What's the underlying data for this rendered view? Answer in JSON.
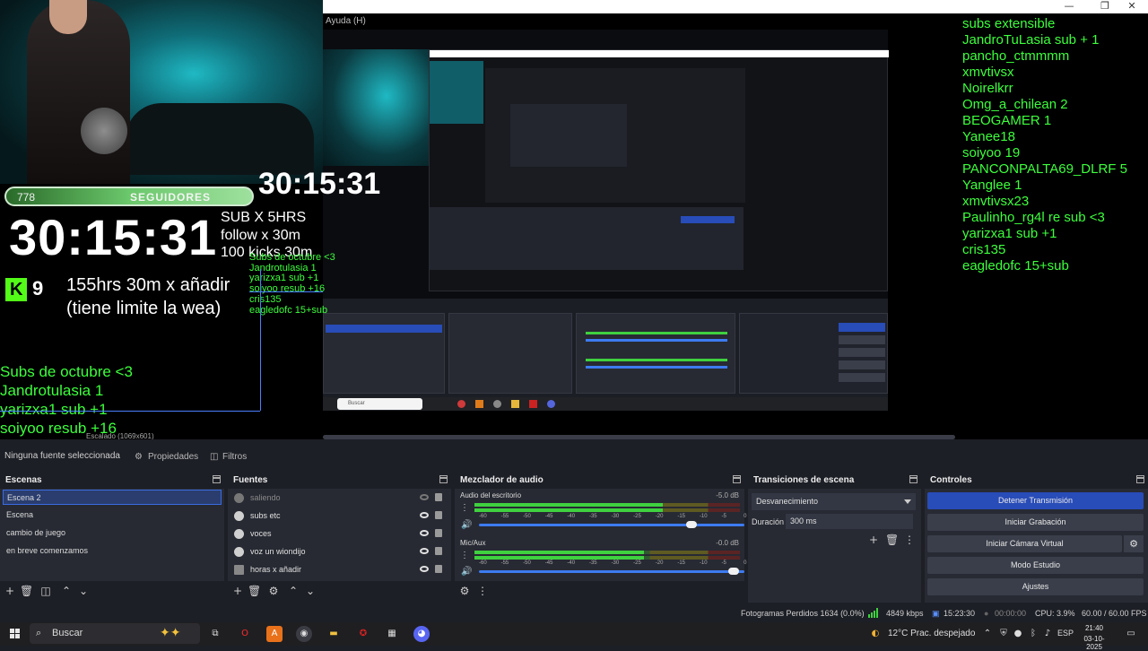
{
  "preview": {
    "menu_help": "Ayuda (H)",
    "followers_count": "778",
    "followers_label": "SEGUIDORES",
    "big_timer": "30:15:31",
    "overlay_timer": "30:15:31",
    "kick_count": "9",
    "limit_line1": "155hrs 30m  x añadir",
    "limit_line2": "(tiene limite la wea)",
    "rules": [
      "SUB X 5HRS",
      "follow x 30m",
      "100 kicks 30m"
    ],
    "left_list": [
      "Subs de octubre <3",
      "Jandrotulasia 1",
      "yarizxa1 sub +1",
      "soiyoo resub +16",
      "cris135",
      "eagledofc 15+sub"
    ],
    "right_list": [
      "subs extensible",
      "JandroTuLasia sub + 1",
      "pancho_ctmmmm",
      "xmvtivsx",
      "Noirelkrr",
      "Omg_a_chilean 2",
      "BEOGAMER 1",
      "Yanee18",
      "soiyoo 19",
      "PANCONPALTA69_DLRF 5",
      "Yanglee 1",
      "xmvtivsx23",
      "Paulinho_rg4l  re sub <3",
      "yarizxa1 sub +1",
      "cris135",
      "eagledofc 15+sub"
    ],
    "nested_search": "Buscar",
    "zoom_label": "Escalado (1069x601)"
  },
  "window_controls": {
    "minimize": "—",
    "maximize": "❐",
    "close": "✕"
  },
  "source_toolbar": {
    "no_source": "Ninguna fuente seleccionada",
    "properties": "Propiedades",
    "filters": "Filtros"
  },
  "scenes": {
    "title": "Escenas",
    "items": [
      "Escena 2",
      "Escena",
      "cambio de juego",
      "en breve comenzamos"
    ]
  },
  "sources": {
    "title": "Fuentes",
    "items": [
      "saliendo",
      "subs etc",
      "voces",
      "voz un wiondijo",
      "horas x añadir"
    ]
  },
  "mixer": {
    "title": "Mezclador de audio",
    "ticks": [
      "-60",
      "-55",
      "-50",
      "-45",
      "-40",
      "-35",
      "-30",
      "-25",
      "-20",
      "-15",
      "-10",
      "-5",
      "0"
    ],
    "channels": [
      {
        "name": "Audio del escritorio",
        "db": "-5.0 dB",
        "level": 0.71,
        "volume": 0.82
      },
      {
        "name": "Mic/Aux",
        "db": "-0.0 dB",
        "level": 0.64,
        "volume": 0.98
      }
    ]
  },
  "transitions": {
    "title": "Transiciones de escena",
    "selected": "Desvanecimiento",
    "duration_label": "Duración",
    "duration_value": "300 ms"
  },
  "controls": {
    "title": "Controles",
    "stop_stream": "Detener Transmisión",
    "start_record": "Iniciar Grabación",
    "start_vcam": "Iniciar Cámara Virtual",
    "studio_mode": "Modo Estudio",
    "settings": "Ajustes"
  },
  "status": {
    "dropped": "Fotogramas Perdidos 1634 (0.0%)",
    "bitrate": "4849 kbps",
    "stream_time": "15:23:30",
    "rec_time": "00:00:00",
    "cpu": "CPU: 3.9%",
    "fps": "60.00 / 60.00 FPS"
  },
  "taskbar": {
    "search": "Buscar",
    "weather": "12°C  Prac. despejado",
    "lang": "ESP",
    "time": "21:40",
    "date": "03-10-2025"
  },
  "colors": {
    "accent": "#284cb8",
    "overlay_green": "#3cff3c",
    "kick_green": "#53fc18"
  }
}
